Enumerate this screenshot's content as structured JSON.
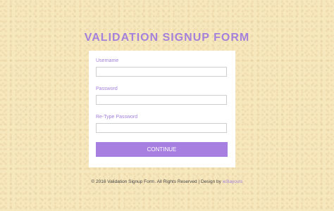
{
  "page": {
    "title": "VALIDATION SIGNUP FORM"
  },
  "form": {
    "fields": [
      {
        "label": "Username",
        "value": "",
        "placeholder": ""
      },
      {
        "label": "Password",
        "value": "",
        "placeholder": ""
      },
      {
        "label": "Re-Type Password",
        "value": "",
        "placeholder": ""
      }
    ],
    "submit_label": "CONTINUE"
  },
  "footer": {
    "text": "© 2016 Validation Signup Form. All Rights Reserved | Design by ",
    "link_text": "w3layouts"
  },
  "colors": {
    "background": "#f7e7bd",
    "accent": "#a381dc",
    "button": "#a67fe0",
    "card": "#ffffff"
  }
}
